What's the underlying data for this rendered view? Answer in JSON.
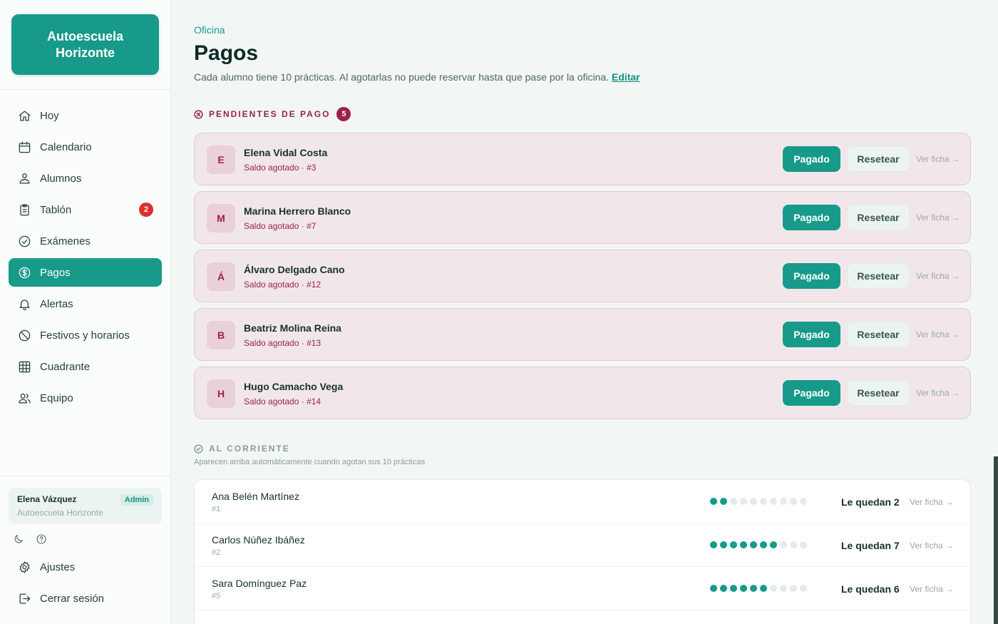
{
  "brand": {
    "line1": "Autoescuela",
    "line2": "Horizonte"
  },
  "nav": [
    {
      "label": "Hoy",
      "icon": "home-icon"
    },
    {
      "label": "Calendario",
      "icon": "calendar-icon"
    },
    {
      "label": "Alumnos",
      "icon": "students-icon"
    },
    {
      "label": "Tablón",
      "icon": "clipboard-icon",
      "badge": "2"
    },
    {
      "label": "Exámenes",
      "icon": "check-circle-icon"
    },
    {
      "label": "Pagos",
      "icon": "dollar-circle-icon",
      "active": true
    },
    {
      "label": "Alertas",
      "icon": "bell-icon"
    },
    {
      "label": "Festivos y horarios",
      "icon": "ban-icon"
    },
    {
      "label": "Cuadrante",
      "icon": "grid-icon"
    },
    {
      "label": "Equipo",
      "icon": "team-icon"
    }
  ],
  "user": {
    "name": "Elena Vázquez",
    "school": "Autoescuela Horizonte",
    "role": "Admin"
  },
  "footer_nav": [
    {
      "label": "Ajustes",
      "icon": "gear-icon"
    },
    {
      "label": "Cerrar sesión",
      "icon": "logout-icon"
    }
  ],
  "header": {
    "breadcrumb": "Oficina",
    "title": "Pagos",
    "description": "Cada alumno tiene 10 prácticas. Al agotarlas no puede reservar hasta que pase por la oficina.",
    "edit_link": "Editar"
  },
  "pending": {
    "heading": "PENDIENTES DE PAGO",
    "count": "5",
    "pay_label": "Pagado",
    "reset_label": "Resetear",
    "view_label": "Ver ficha →",
    "items": [
      {
        "initial": "E",
        "name": "Elena Vidal Costa",
        "status": "Saldo agotado · #3"
      },
      {
        "initial": "M",
        "name": "Marina Herrero Blanco",
        "status": "Saldo agotado · #7"
      },
      {
        "initial": "Á",
        "name": "Álvaro Delgado Cano",
        "status": "Saldo agotado · #12"
      },
      {
        "initial": "B",
        "name": "Beatriz Molina Reina",
        "status": "Saldo agotado · #13"
      },
      {
        "initial": "H",
        "name": "Hugo Camacho Vega",
        "status": "Saldo agotado · #14"
      }
    ]
  },
  "current": {
    "heading": "AL CORRIENTE",
    "subtitle": "Aparecen arriba automáticamente cuando agotan sus 10 prácticas",
    "view_label": "Ver ficha →",
    "total_practices": 10,
    "items": [
      {
        "name": "Ana Belén Martínez",
        "id": "#1",
        "remaining": 2,
        "remaining_label": "Le quedan 2"
      },
      {
        "name": "Carlos Núñez Ibáñez",
        "id": "#2",
        "remaining": 7,
        "remaining_label": "Le quedan 7"
      },
      {
        "name": "Sara Domínguez Paz",
        "id": "#5",
        "remaining": 6,
        "remaining_label": "Le quedan 6"
      }
    ]
  },
  "colors": {
    "accent": "#179a89",
    "danger": "#9b2147",
    "badge": "#d93131"
  }
}
